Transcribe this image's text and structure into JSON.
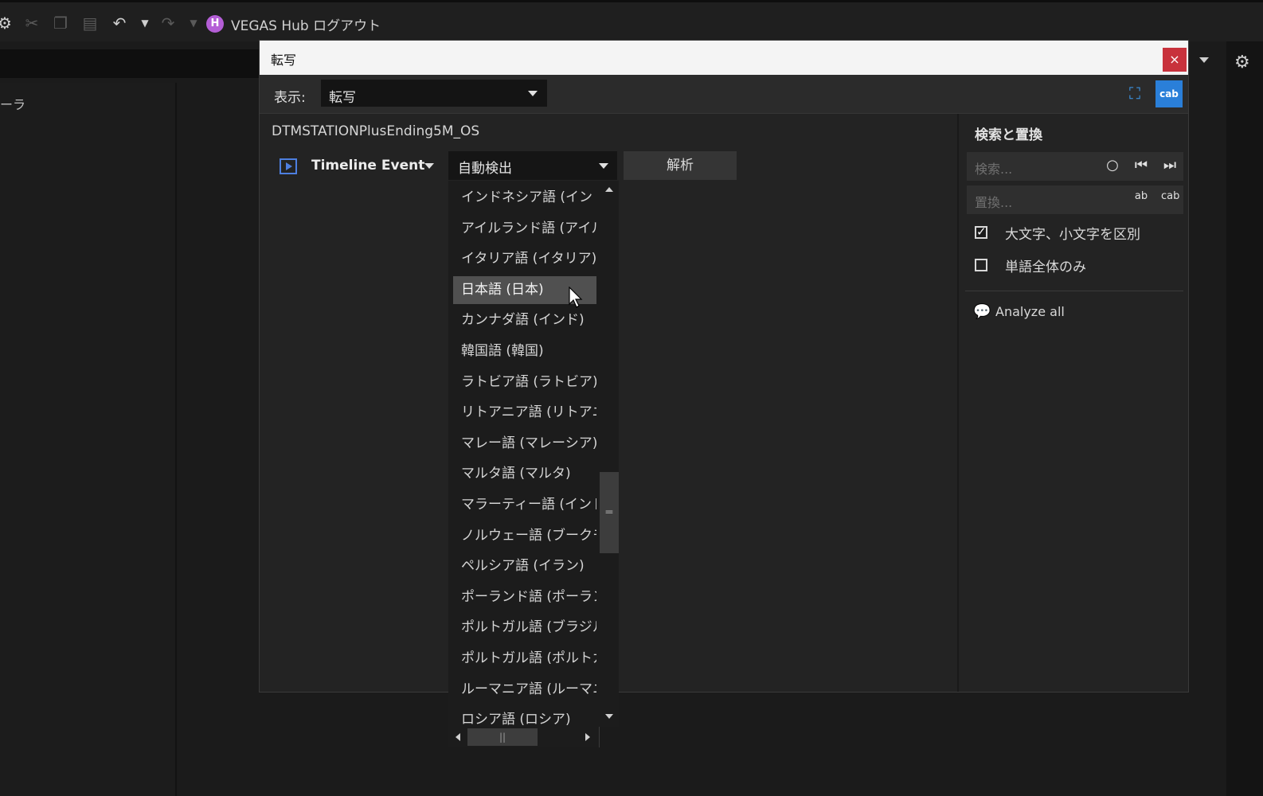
{
  "toolbar": {
    "hub_text": "VEGAS Hub ログアウト",
    "hub_logo": "H",
    "icons": [
      "gear-icon",
      "scissors-icon",
      "copy-icon",
      "paste-icon",
      "undo-icon",
      "undo-dropdown-icon",
      "redo-icon",
      "redo-dropdown-icon"
    ]
  },
  "left_pane": {
    "label": "ーラ"
  },
  "dialog": {
    "title": "転写",
    "close_label": "×",
    "view_label": "表示:",
    "view_value": "転写",
    "file_name": "DTMSTATIONPlusEnding5M_OS",
    "source_label": "Timeline Event",
    "language_value": "自動検出",
    "analyze_label": "解析",
    "cc_icon_text": "cab\nac",
    "side": {
      "title": "検索と置換",
      "search_placeholder": "検索...",
      "replace_placeholder": "置換...",
      "match_case_label": "大文字、小文字を区別",
      "match_case_checked": true,
      "whole_word_label": "単語全体のみ",
      "whole_word_checked": false,
      "analyze_all_label": "Analyze all"
    }
  },
  "language_list": {
    "items": [
      "インドネシア語 (インドネシア)",
      "アイルランド語 (アイルランド)",
      "イタリア語 (イタリア)",
      "日本語 (日本)",
      "カンナダ語 (インド)",
      "韓国語 (韓国)",
      "ラトビア語 (ラトビア)",
      "リトアニア語 (リトアニア)",
      "マレー語 (マレーシア)",
      "マルタ語 (マルタ)",
      "マラーティー語 (インド)",
      "ノルウェー語 (ブークモール)",
      "ペルシア語 (イラン)",
      "ポーランド語 (ポーランド)",
      "ポルトガル語 (ブラジル)",
      "ポルトガル語 (ポルトガル)",
      "ルーマニア語 (ルーマニア)",
      "ロシア語 (ロシア)"
    ],
    "selected": "日本語 (日本)"
  }
}
